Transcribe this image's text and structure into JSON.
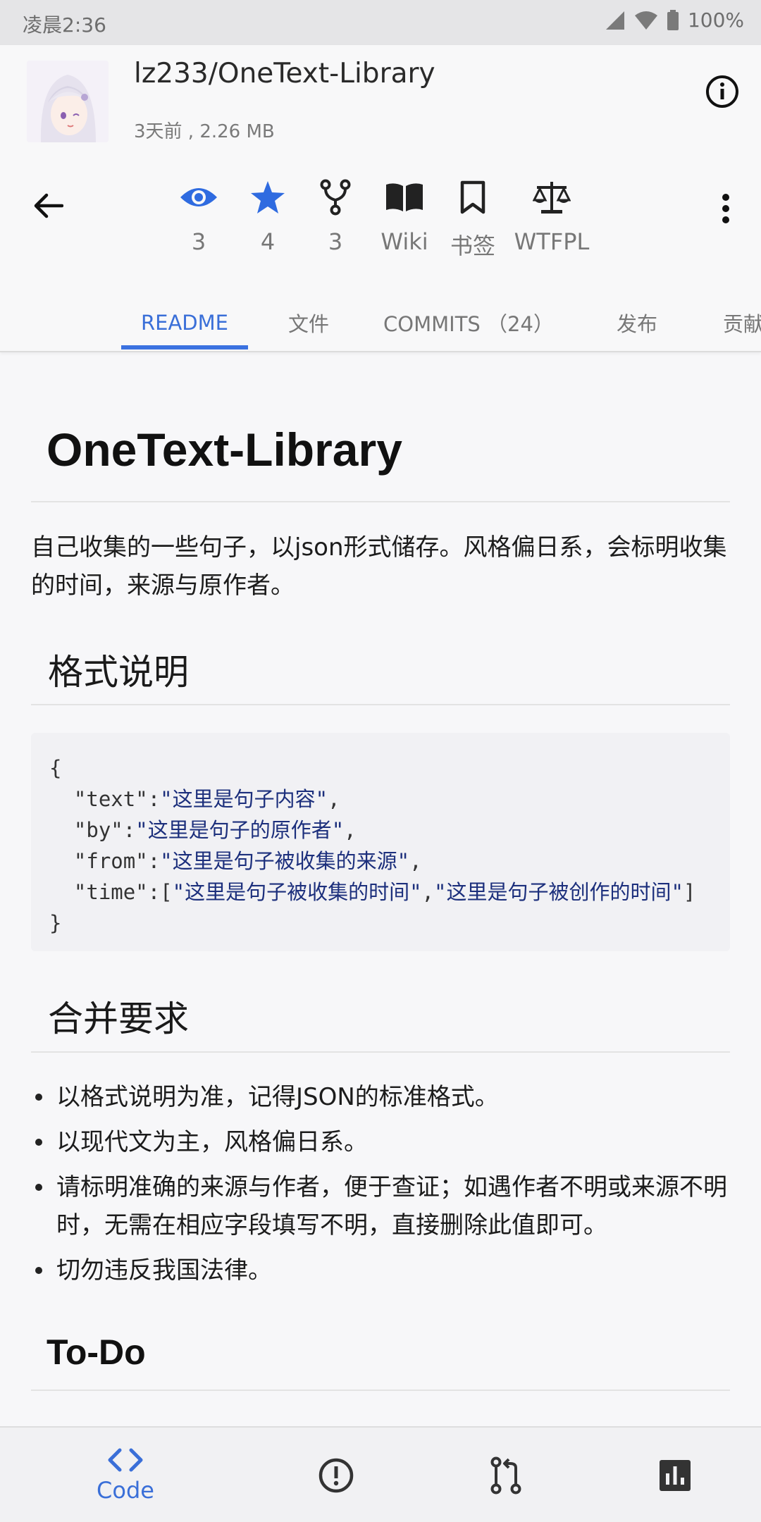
{
  "status_bar": {
    "time": "凌晨2:36",
    "battery": "100%"
  },
  "repo": {
    "name": "lz233/OneText-Library",
    "meta": "3天前 , 2.26 MB"
  },
  "stats": [
    {
      "icon": "eye-icon",
      "value": "3",
      "color": "#2f6be0"
    },
    {
      "icon": "star-icon",
      "value": "4",
      "color": "#2f6be0"
    },
    {
      "icon": "fork-icon",
      "value": "3",
      "color": "#222"
    },
    {
      "icon": "book-icon",
      "value": "Wiki",
      "color": "#222"
    },
    {
      "icon": "bookmark-icon",
      "value": "书签",
      "color": "#222"
    },
    {
      "icon": "scale-icon",
      "value": "WTFPL",
      "color": "#222"
    }
  ],
  "tabs": [
    {
      "label": "README",
      "active": true
    },
    {
      "label": "文件"
    },
    {
      "label": "COMMITS （24）"
    },
    {
      "label": "发布"
    },
    {
      "label": "贡献"
    }
  ],
  "readme": {
    "title": "OneText-Library",
    "intro": "自己收集的一些句子，以json形式储存。风格偏日系，会标明收集的时间，来源与原作者。",
    "format_heading": "格式说明",
    "code": {
      "open": "{",
      "text_key": "\"text\"",
      "text_val": "\"这里是句子内容\"",
      "by_key": "\"by\"",
      "by_val": "\"这里是句子的原作者\"",
      "from_key": "\"from\"",
      "from_val": "\"这里是句子被收集的来源\"",
      "time_key": "\"time\"",
      "time_val1": "\"这里是句子被收集的时间\"",
      "time_val2": "\"这里是句子被创作的时间\"",
      "close": "}"
    },
    "merge_heading": "合并要求",
    "merge_items": [
      "以格式说明为准，记得JSON的标准格式。",
      "以现代文为主，风格偏日系。",
      "请标明准确的来源与作者，便于查证；如遇作者不明或来源不明时，无需在相应字段填写不明，直接删除此值即可。",
      "切勿违反我国法律。"
    ],
    "todo_heading": "To-Do"
  },
  "bottom_nav": {
    "code_label": "Code"
  },
  "colors": {
    "accent": "#3a6fd8"
  }
}
